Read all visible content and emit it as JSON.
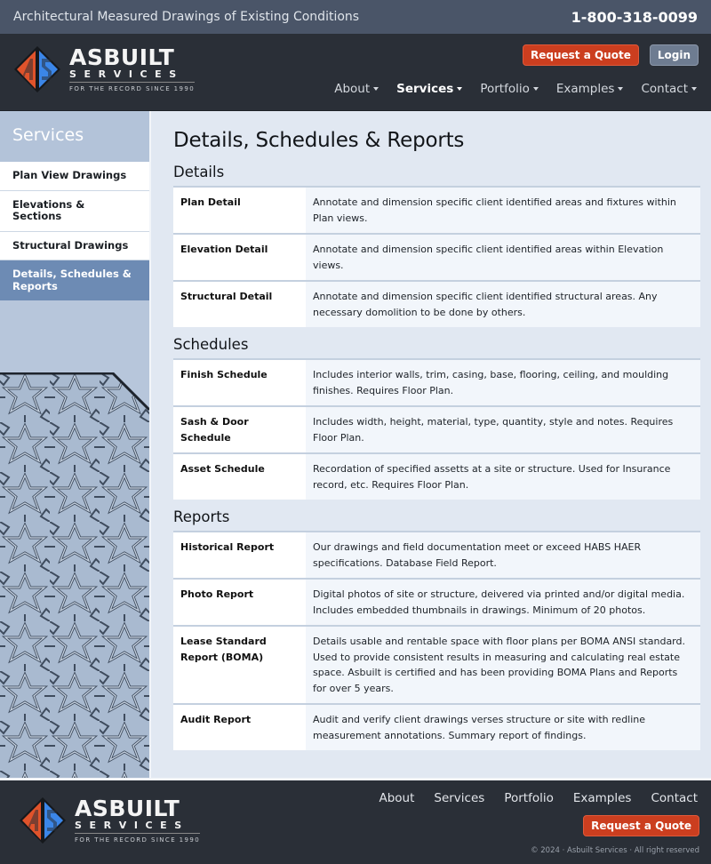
{
  "topbar": {
    "tagline": "Architectural Measured Drawings of Existing Conditions",
    "phone": "1-800-318-0099"
  },
  "brand": {
    "name": "ASBUILT",
    "sub": "SERVICES",
    "since": "FOR THE RECORD SINCE 1990",
    "colors": {
      "orange": "#e0532b",
      "blue": "#3b86e8"
    }
  },
  "header": {
    "quote_label": "Request a Quote",
    "login_label": "Login",
    "nav": [
      {
        "label": "About"
      },
      {
        "label": "Services",
        "active": true
      },
      {
        "label": "Portfolio"
      },
      {
        "label": "Examples"
      },
      {
        "label": "Contact"
      }
    ]
  },
  "sidebar": {
    "title": "Services",
    "items": [
      {
        "label": "Plan View Drawings"
      },
      {
        "label": "Elevations & Sections"
      },
      {
        "label": "Structural Drawings"
      },
      {
        "label": "Details, Schedules & Reports",
        "active": true
      }
    ]
  },
  "main": {
    "title": "Details, Schedules & Reports",
    "sections": [
      {
        "heading": "Details",
        "rows": [
          {
            "term": "Plan Detail",
            "desc": "Annotate and dimension specific client identified areas and fixtures within Plan views."
          },
          {
            "term": "Elevation Detail",
            "desc": "Annotate and dimension specific client identified areas within Elevation views."
          },
          {
            "term": "Structural Detail",
            "desc": "Annotate and dimension specific client identified structural areas. Any necessary domolition to be done by others."
          }
        ]
      },
      {
        "heading": "Schedules",
        "rows": [
          {
            "term": "Finish Schedule",
            "desc": "Includes interior walls, trim, casing, base, flooring, ceiling, and moulding finishes. Requires Floor Plan."
          },
          {
            "term": "Sash & Door Schedule",
            "desc": "Includes width, height, material, type, quantity, style and notes. Requires Floor Plan."
          },
          {
            "term": "Asset Schedule",
            "desc": "Recordation of specified assetts at a site or structure. Used for Insurance record, etc. Requires Floor Plan."
          }
        ]
      },
      {
        "heading": "Reports",
        "rows": [
          {
            "term": "Historical Report",
            "desc": "Our drawings and field documentation meet or exceed HABS HAER specifications. Database Field Report."
          },
          {
            "term": "Photo Report",
            "desc": "Digital photos of site or structure, deivered via printed and/or digital media. Includes embedded thumbnails in drawings. Minimum of 20 photos."
          },
          {
            "term": "Lease Standard Report (BOMA)",
            "desc": "Details usable and rentable space with floor plans per BOMA ANSI standard. Used to provide consistent results in measuring and calculating real estate space. Asbuilt is certified and has been providing BOMA Plans and Reports for over 5 years."
          },
          {
            "term": "Audit Report",
            "desc": "Audit and verify client drawings verses structure or site with redline measurement annotations. Summary report of findings."
          }
        ]
      }
    ]
  },
  "footer": {
    "nav": [
      {
        "label": "About"
      },
      {
        "label": "Services"
      },
      {
        "label": "Portfolio"
      },
      {
        "label": "Examples"
      },
      {
        "label": "Contact"
      }
    ],
    "quote_label": "Request a Quote",
    "copyright": "© 2024 · Asbuilt Services · All right reserved"
  }
}
